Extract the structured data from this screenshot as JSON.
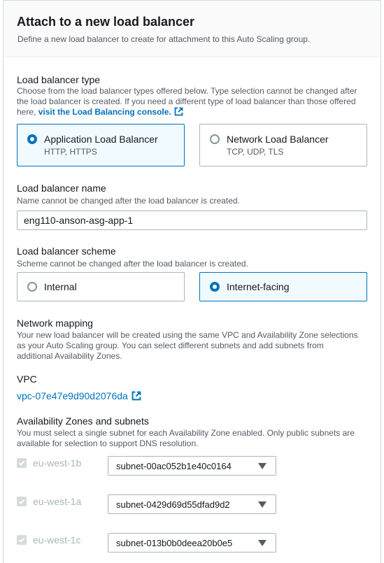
{
  "header": {
    "title": "Attach to a new load balancer",
    "description": "Define a new load balancer to create for attachment to this Auto Scaling group."
  },
  "lb_type": {
    "label": "Load balancer type",
    "description_line1": "Choose from the load balancer types offered below. Type selection cannot be changed after",
    "description_line2": "the load balancer is created. If you need a different type of load balancer than those offered",
    "description_line3_prefix": "here,",
    "link": "visit the Load Balancing console.",
    "options": [
      {
        "title": "Application Load Balancer",
        "subtitle": "HTTP, HTTPS",
        "selected": true
      },
      {
        "title": "Network Load Balancer",
        "subtitle": "TCP, UDP, TLS",
        "selected": false
      }
    ]
  },
  "lb_name": {
    "label": "Load balancer name",
    "description": "Name cannot be changed after the load balancer is created.",
    "value": "eng110-anson-asg-app-1"
  },
  "lb_scheme": {
    "label": "Load balancer scheme",
    "description": "Scheme cannot be changed after the load balancer is created.",
    "options": [
      {
        "title": "Internal",
        "selected": false
      },
      {
        "title": "Internet-facing",
        "selected": true
      }
    ]
  },
  "network_mapping": {
    "label": "Network mapping",
    "description_line1": "Your new load balancer will be created using the same VPC and Availability Zone selections",
    "description_line2": "as your Auto Scaling group. You can select different subnets and add subnets from",
    "description_line3": "additional Availability Zones."
  },
  "vpc": {
    "label": "VPC",
    "value": "vpc-07e47e9d90d2076da"
  },
  "az": {
    "label": "Availability Zones and subnets",
    "description_line1": "You must select a single subnet for each Availability Zone enabled. Only public subnets are",
    "description_line2": "available for selection to support DNS resolution.",
    "rows": [
      {
        "zone": "eu-west-1b",
        "subnet": "subnet-00ac052b1e40c0164",
        "checked": true
      },
      {
        "zone": "eu-west-1a",
        "subnet": "subnet-0429d69d55dfad9d2",
        "checked": true
      },
      {
        "zone": "eu-west-1c",
        "subnet": "subnet-013b0b0deea20b0e5",
        "checked": true
      }
    ]
  },
  "colors": {
    "accent": "#0073bb",
    "selected_bg": "#f1faff",
    "border": "#aab7b8",
    "muted_text": "#545b64"
  },
  "icons": {
    "external_link": "external-link-icon",
    "dropdown": "caret-down-icon",
    "checkbox": "check-icon"
  }
}
